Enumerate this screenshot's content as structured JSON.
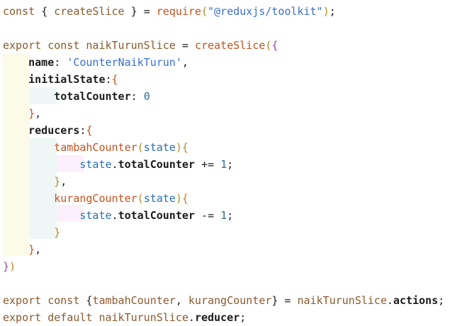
{
  "code": {
    "lines": [
      [
        {
          "t": "const",
          "c": "kw"
        },
        {
          "t": " ",
          "c": "punc"
        },
        {
          "t": "{",
          "c": "punc"
        },
        {
          "t": " ",
          "c": "punc"
        },
        {
          "t": "createSlice",
          "c": "var"
        },
        {
          "t": " ",
          "c": "punc"
        },
        {
          "t": "}",
          "c": "punc"
        },
        {
          "t": " ",
          "c": "punc"
        },
        {
          "t": "=",
          "c": "op"
        },
        {
          "t": " ",
          "c": "punc"
        },
        {
          "t": "require",
          "c": "fn"
        },
        {
          "t": "(",
          "c": "br1"
        },
        {
          "t": "\"@reduxjs/toolkit\"",
          "c": "str"
        },
        {
          "t": ")",
          "c": "br1"
        },
        {
          "t": ";",
          "c": "punc"
        }
      ],
      [],
      [
        {
          "t": "export",
          "c": "kw"
        },
        {
          "t": " ",
          "c": "punc"
        },
        {
          "t": "const",
          "c": "kw"
        },
        {
          "t": " ",
          "c": "punc"
        },
        {
          "t": "naikTurunSlice",
          "c": "var"
        },
        {
          "t": " ",
          "c": "punc"
        },
        {
          "t": "=",
          "c": "op"
        },
        {
          "t": " ",
          "c": "punc"
        },
        {
          "t": "createSlice",
          "c": "fn"
        },
        {
          "t": "(",
          "c": "br1"
        },
        {
          "t": "{",
          "c": "br2"
        }
      ],
      [
        {
          "t": "    ",
          "c": "punc"
        },
        {
          "t": "name",
          "c": "prop"
        },
        {
          "t": ": ",
          "c": "punc"
        },
        {
          "t": "'CounterNaikTurun'",
          "c": "str"
        },
        {
          "t": ",",
          "c": "punc"
        }
      ],
      [
        {
          "t": "    ",
          "c": "punc"
        },
        {
          "t": "initialState",
          "c": "prop"
        },
        {
          "t": ":",
          "c": "punc"
        },
        {
          "t": "{",
          "c": "br3"
        }
      ],
      [
        {
          "t": "        ",
          "c": "punc"
        },
        {
          "t": "totalCounter",
          "c": "prop"
        },
        {
          "t": ": ",
          "c": "punc"
        },
        {
          "t": "0",
          "c": "num"
        }
      ],
      [
        {
          "t": "    ",
          "c": "punc"
        },
        {
          "t": "}",
          "c": "br3"
        },
        {
          "t": ",",
          "c": "punc"
        }
      ],
      [
        {
          "t": "    ",
          "c": "punc"
        },
        {
          "t": "reducers",
          "c": "prop"
        },
        {
          "t": ":",
          "c": "punc"
        },
        {
          "t": "{",
          "c": "br3"
        }
      ],
      [
        {
          "t": "        ",
          "c": "punc"
        },
        {
          "t": "tambahCounter",
          "c": "fn"
        },
        {
          "t": "(",
          "c": "br1"
        },
        {
          "t": "state",
          "c": "param"
        },
        {
          "t": ")",
          "c": "br1"
        },
        {
          "t": "{",
          "c": "br1"
        }
      ],
      [
        {
          "t": "            ",
          "c": "punc"
        },
        {
          "t": "state",
          "c": "param"
        },
        {
          "t": ".",
          "c": "punc"
        },
        {
          "t": "totalCounter",
          "c": "prop"
        },
        {
          "t": " += ",
          "c": "op"
        },
        {
          "t": "1",
          "c": "num"
        },
        {
          "t": ";",
          "c": "punc"
        }
      ],
      [
        {
          "t": "        ",
          "c": "punc"
        },
        {
          "t": "}",
          "c": "br1"
        },
        {
          "t": ",",
          "c": "punc"
        }
      ],
      [
        {
          "t": "        ",
          "c": "punc"
        },
        {
          "t": "kurangCounter",
          "c": "fn"
        },
        {
          "t": "(",
          "c": "br1"
        },
        {
          "t": "state",
          "c": "param"
        },
        {
          "t": ")",
          "c": "br1"
        },
        {
          "t": "{",
          "c": "br1"
        }
      ],
      [
        {
          "t": "            ",
          "c": "punc"
        },
        {
          "t": "state",
          "c": "param"
        },
        {
          "t": ".",
          "c": "punc"
        },
        {
          "t": "totalCounter",
          "c": "prop"
        },
        {
          "t": " -= ",
          "c": "op"
        },
        {
          "t": "1",
          "c": "num"
        },
        {
          "t": ";",
          "c": "punc"
        }
      ],
      [
        {
          "t": "        ",
          "c": "punc"
        },
        {
          "t": "}",
          "c": "br1"
        }
      ],
      [
        {
          "t": "    ",
          "c": "punc"
        },
        {
          "t": "}",
          "c": "br3"
        },
        {
          "t": ",",
          "c": "punc"
        }
      ],
      [
        {
          "t": "}",
          "c": "br2"
        },
        {
          "t": ")",
          "c": "br1"
        }
      ],
      [],
      [
        {
          "t": "export",
          "c": "kw"
        },
        {
          "t": " ",
          "c": "punc"
        },
        {
          "t": "const",
          "c": "kw"
        },
        {
          "t": " ",
          "c": "punc"
        },
        {
          "t": "{",
          "c": "punc"
        },
        {
          "t": "tambahCounter",
          "c": "var"
        },
        {
          "t": ", ",
          "c": "punc"
        },
        {
          "t": "kurangCounter",
          "c": "var"
        },
        {
          "t": "}",
          "c": "punc"
        },
        {
          "t": " ",
          "c": "punc"
        },
        {
          "t": "=",
          "c": "op"
        },
        {
          "t": " ",
          "c": "punc"
        },
        {
          "t": "naikTurunSlice",
          "c": "var"
        },
        {
          "t": ".",
          "c": "punc"
        },
        {
          "t": "actions",
          "c": "prop"
        },
        {
          "t": ";",
          "c": "punc"
        }
      ],
      [
        {
          "t": "export",
          "c": "kw"
        },
        {
          "t": " ",
          "c": "punc"
        },
        {
          "t": "default",
          "c": "kw"
        },
        {
          "t": " ",
          "c": "punc"
        },
        {
          "t": "naikTurunSlice",
          "c": "var"
        },
        {
          "t": ".",
          "c": "punc"
        },
        {
          "t": "reducer",
          "c": "prop"
        },
        {
          "t": ";",
          "c": "punc"
        }
      ]
    ]
  }
}
